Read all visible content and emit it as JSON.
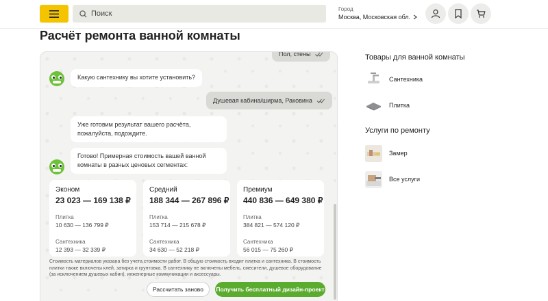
{
  "header": {
    "search_placeholder": "Поиск",
    "city_label": "Город",
    "city_value": "Москва, Московская обл.",
    "icons": [
      "menu-icon",
      "search-icon",
      "chevron-right-icon",
      "user-icon",
      "bookmark-icon",
      "cart-icon"
    ]
  },
  "page": {
    "title": "Расчёт ремонта ванной комнаты"
  },
  "chat": {
    "messages": [
      {
        "from": "user",
        "text": "Пол, стены"
      },
      {
        "from": "bot",
        "text": "Какую сантехнику вы хотите установить?"
      },
      {
        "from": "user",
        "text": "Душевая кабина/ширма, Раковина"
      },
      {
        "from": "bot",
        "text": "Уже готовим результат вашего расчёта, пожалуйста, подождите."
      },
      {
        "from": "bot",
        "text": "Готово! Примерная стоимость вашей ванной комнаты в разных ценовых сегментах:"
      }
    ],
    "price_cards": [
      {
        "tier": "Эконом",
        "range": "23 023 — 169 138 ₽",
        "tile_label": "Плитка",
        "tile_range": "10 630 — 136 799 ₽",
        "plumbing_label": "Сантехника",
        "plumbing_range": "12 393 — 32 339 ₽"
      },
      {
        "tier": "Средний",
        "range": "188 344 — 267 896 ₽",
        "tile_label": "Плитка",
        "tile_range": "153 714 — 215 678 ₽",
        "plumbing_label": "Сантехника",
        "plumbing_range": "34 630 — 52 218 ₽"
      },
      {
        "tier": "Премиум",
        "range": "440 836 — 649 380 ₽",
        "tile_label": "Плитка",
        "tile_range": "384 821 — 574 120 ₽",
        "plumbing_label": "Сантехника",
        "plumbing_range": "56 015 — 75 260 ₽"
      }
    ],
    "disclaimer": "Стоимость материалов указана без учета стоимости работ. В общую стоимость входит плитка и сантехника. В стоимость плитки также включены клей, затирка и грунтовка. В сантехнику не включены мебель, смесители, душевое оборудование (за исключением душевых кабин), инженерные коммуникации и аксессуары.",
    "recalc_label": "Рассчитать заново",
    "design_label": "Получить бесплатный дизайн-проект"
  },
  "sidebar": {
    "goods_title": "Товары для ванной комнаты",
    "goods": [
      {
        "label": "Сантехника"
      },
      {
        "label": "Плитка"
      }
    ],
    "services_title": "Услуги по ремонту",
    "services": [
      {
        "label": "Замер"
      },
      {
        "label": "Все услуги"
      }
    ]
  },
  "colors": {
    "accent_yellow": "#f5c400",
    "accent_green": "#5aab2e",
    "user_bubble": "#d9d9d6"
  }
}
